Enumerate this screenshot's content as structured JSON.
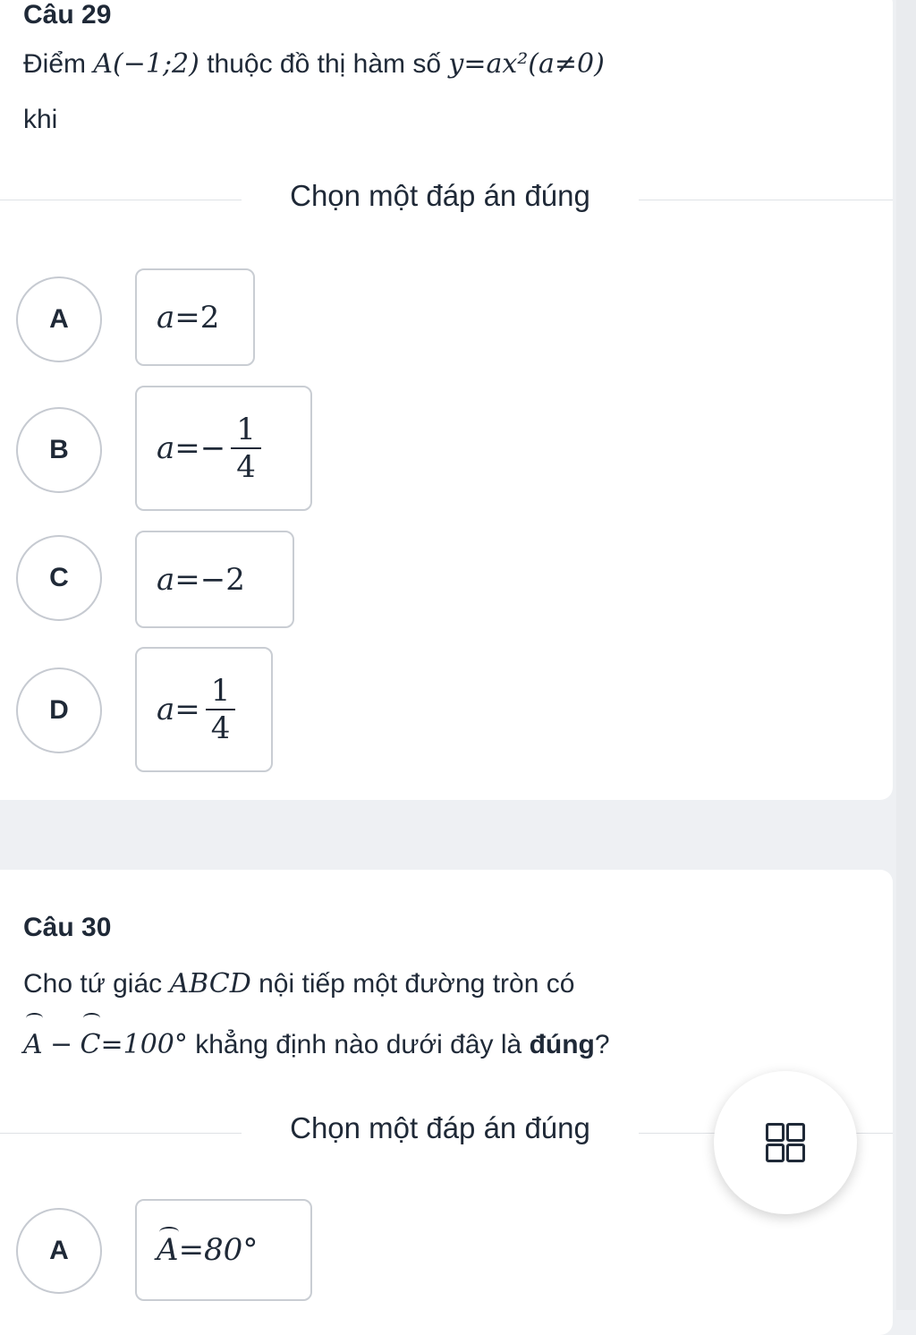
{
  "q29": {
    "title": "Câu 29",
    "line1_prefix": "Điểm",
    "point": "A(−1;2)",
    "line1_mid": "thuộc đồ thị hàm số",
    "function": "y=ax²(a≠0)",
    "line2": "khi",
    "choose_label": "Chọn một đáp án đúng",
    "options": [
      {
        "letter": "A",
        "lhs": "a=",
        "value": "2"
      },
      {
        "letter": "B",
        "lhs": "a=−",
        "num": "1",
        "den": "4"
      },
      {
        "letter": "C",
        "lhs": "a=",
        "value": "−2"
      },
      {
        "letter": "D",
        "lhs": "a=",
        "num": "1",
        "den": "4"
      }
    ]
  },
  "q30": {
    "title": "Câu 30",
    "line1_prefix": "Cho tứ giác",
    "shape": "ABCD",
    "line1_suffix": "nội tiếp một đường tròn có",
    "angle_a": "A",
    "minus": "−",
    "angle_c": "C",
    "equals_value": "=100°",
    "line2_suffix": "khẳng định nào dưới đây là",
    "bold_word": "đúng",
    "question_mark": "?",
    "choose_label": "Chọn một đáp án đúng",
    "options": [
      {
        "letter": "A",
        "angle": "A",
        "value": "=80°"
      }
    ]
  },
  "fab": {
    "icon": "grid-icon"
  }
}
